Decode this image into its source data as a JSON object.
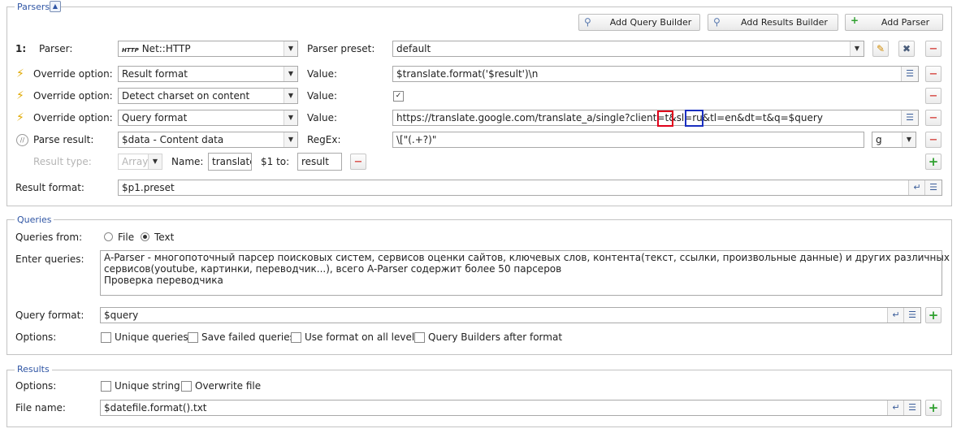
{
  "parsers": {
    "legend": "Parsers",
    "toggle": "▲",
    "buttons": {
      "add_query_builder": "Add Query Builder",
      "add_results_builder": "Add Results Builder",
      "add_parser": "Add Parser"
    },
    "row_number": "1:",
    "parser_label": "Parser:",
    "parser_value": "Net::HTTP",
    "parser_icon_text": "HTTP",
    "preset_label": "Parser preset:",
    "preset_value": "default",
    "override_label": "Override option:",
    "value_label": "Value:",
    "overrides": [
      {
        "option": "Result format",
        "value": "$translate.format('$result')\\n"
      },
      {
        "option": "Detect charset on content",
        "value": "✓"
      },
      {
        "option": "Query format",
        "value": "https://translate.google.com/translate_a/single?client=t&sl=ru&tl=en&dt=t&q=$query"
      }
    ],
    "parse_result_label": "Parse result:",
    "parse_result_value": "$data - Content data",
    "regex_label": "RegEx:",
    "regex_value": "\\[\"(.+?)\"",
    "regex_flags": "g",
    "result_type_label": "Result type:",
    "result_type_value": "Array",
    "name_label": "Name:",
    "name_value": "translate",
    "to_label": "$1 to:",
    "to_value": "result",
    "result_format_label": "Result format:",
    "result_format_value": "$p1.preset"
  },
  "queries": {
    "legend": "Queries",
    "from_label": "Queries from:",
    "from_options": [
      "File",
      "Text"
    ],
    "enter_label": "Enter queries:",
    "lines": [
      "A-Parser - многопоточный парсер поисковых систем, сервисов оценки сайтов, ключевых слов, контента(текст, ссылки, произвольные данные) и других различных",
      "сервисов(youtube, картинки, переводчик...), всего A-Parser содержит более 50 парсеров",
      "Проверка переводчика"
    ],
    "format_label": "Query format:",
    "format_value": "$query",
    "options_label": "Options:",
    "options": [
      "Unique queries",
      "Save failed queries",
      "Use format on all levels",
      "Query Builders after format"
    ]
  },
  "results": {
    "legend": "Results",
    "options_label": "Options:",
    "options": [
      "Unique string",
      "Overwrite file"
    ],
    "file_label": "File name:",
    "file_value": "$datefile.format().txt"
  },
  "icons": {
    "arrow": "▼",
    "list": "☰",
    "wrap": "↵",
    "minus": "−",
    "plus": "+",
    "bolt": "⚡",
    "edit": "✎",
    "tools": "✖",
    "builder": "⚲"
  }
}
